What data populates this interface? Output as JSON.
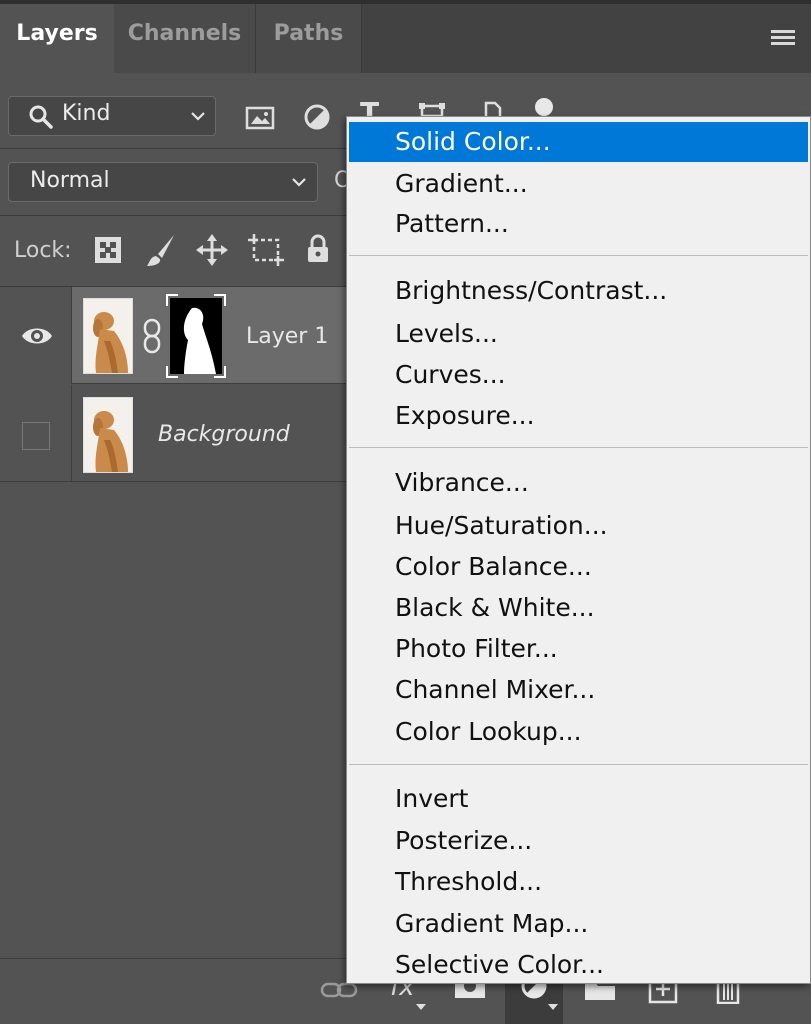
{
  "tabs": [
    {
      "label": "Layers"
    },
    {
      "label": "Channels"
    },
    {
      "label": "Paths"
    }
  ],
  "filter": {
    "kind_label": "Kind"
  },
  "blend": {
    "mode": "Normal",
    "opacity_peek": "O"
  },
  "lock": {
    "label": "Lock:"
  },
  "layers": [
    {
      "name": "Layer 1",
      "visible": true,
      "has_mask": true
    },
    {
      "name": "Background",
      "visible": false,
      "has_mask": false
    }
  ],
  "bottom_bar": {
    "fx_label": "fx"
  },
  "adjustment_menu": {
    "highlighted": "Solid Color...",
    "groups": [
      [
        "Solid Color...",
        "Gradient...",
        "Pattern..."
      ],
      [
        "Brightness/Contrast...",
        "Levels...",
        "Curves...",
        "Exposure..."
      ],
      [
        "Vibrance...",
        "Hue/Saturation...",
        "Color Balance...",
        "Black & White...",
        "Photo Filter...",
        "Channel Mixer...",
        "Color Lookup..."
      ],
      [
        "Invert",
        "Posterize...",
        "Threshold...",
        "Gradient Map...",
        "Selective Color..."
      ]
    ]
  },
  "colors": {
    "panel_bg": "#535353",
    "menu_bg": "#f0f0f0",
    "highlight": "#0078d7",
    "selected_layer": "#6b6b6b"
  }
}
